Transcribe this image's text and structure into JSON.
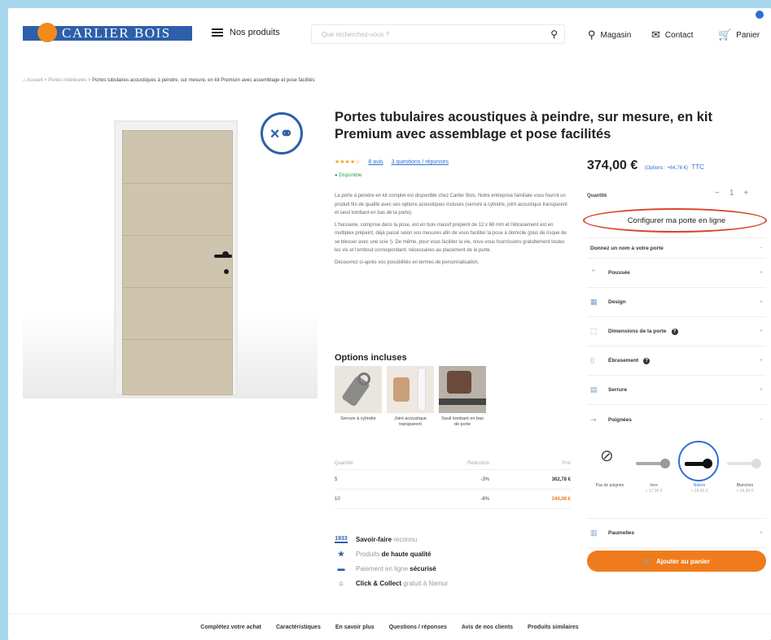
{
  "header": {
    "logo_text": "CARLIER BOIS",
    "products_label": "Nos produits",
    "search_placeholder": "Que recherchez-vous ?",
    "store_label": "Magasin",
    "contact_label": "Contact",
    "cart_label": "Panier"
  },
  "breadcrumb": {
    "home": "Accueil",
    "sep1": ">",
    "cat": "Portes intérieures",
    "sep2": ">",
    "current": "Portes tubulaires acoustiques à peindre, sur mesure, en kit Premium avec assemblage et pose facilités"
  },
  "product": {
    "title": "Portes tubulaires acoustiques à peindre, sur mesure, en kit Premium avec assemblage et pose facilités",
    "stars": "★★★★☆",
    "reviews_link": "8 avis",
    "questions_link": "3 questions / réponses",
    "stock": "Disponible",
    "desc_p1": "La porte à peindre en kit complet est disponible chez Carlier Bois. Notre entreprise familiale vous fournit un produit fini de qualité avec ses options acoustiques incluses (serrure à cylindre, joint acoustique transparent et seuil tombant en bas de la porte).",
    "desc_p2": "L'huisserie, comprise dans la pose, est en bois massif prépeint de 12 x 68 mm et l'ébrasement est en multiplex prépeint, déjà passé selon vos mesures afin de vous faciliter la pose à domicile (plus de risque de se blesser avec une scie !). De même, pour vous faciliter la vie, nous vous fournissons gratuitement toutes les vis et l'embout correspondant, nécessaires au placement de la porte.",
    "desc_p3": "Découvrez ci-après vos possibilités en termes de personnalisation."
  },
  "options": {
    "title": "Options incluses",
    "items": [
      {
        "label": "Serrure à cylindre"
      },
      {
        "label": "Joint acoustique transparent"
      },
      {
        "label": "Seuil tombant en bas de porte"
      }
    ]
  },
  "qty_table": {
    "headers": [
      "Quantité",
      "Réduction",
      "Prix"
    ],
    "rows": [
      {
        "qty": "5",
        "reduction": "-3%",
        "price": "362,78 €"
      },
      {
        "qty": "10",
        "reduction": "-8%",
        "price": "344,08 €"
      }
    ]
  },
  "features": [
    {
      "icon": "1933",
      "bold_first": "Savoir-faire",
      "rest": " reconnu"
    },
    {
      "icon": "★",
      "light": "Produits ",
      "bold": "de haute qualité"
    },
    {
      "icon": "▬",
      "light": "Paiement en ligne ",
      "bold": "sécurisé"
    },
    {
      "icon": "⌂",
      "bold_first": "Click & Collect",
      "rest": " gratuit à Namur"
    }
  ],
  "purchase": {
    "price": "374,00 €",
    "price_options": "(Options : +64,76 €)",
    "price_ttc": "TTC",
    "qty_label": "Quantité",
    "qty_value": "1",
    "minus": "−",
    "plus": "+",
    "config_button": "Configurer ma porte en ligne",
    "add_to_cart": "Ajouter au panier"
  },
  "accordion": [
    {
      "label": "Donnez un nom à votre porte",
      "icon": "",
      "chev": "−"
    },
    {
      "label": "Poussée",
      "icon": "⌃",
      "chev": "+"
    },
    {
      "label": "Design",
      "icon": "▦",
      "chev": "+"
    },
    {
      "label": "Dimensions de la porte",
      "icon": "⬚",
      "chev": "+",
      "help": "?"
    },
    {
      "label": "Ébrasement",
      "icon": "⌷",
      "chev": "+",
      "help": "?"
    },
    {
      "label": "Serrure",
      "icon": "▤",
      "chev": "+"
    },
    {
      "label": "Poignées",
      "icon": "⊸",
      "chev": "−"
    }
  ],
  "handles": [
    {
      "label": "Pas de poignée",
      "sub": ""
    },
    {
      "label": "Inox",
      "sub": "+ 17,90 €"
    },
    {
      "label": "Noires",
      "sub": "+ 26,00 €"
    },
    {
      "label": "Blanches",
      "sub": "+ 26,00 €"
    }
  ],
  "hinges": {
    "label": "Paumelles",
    "icon": "▥",
    "chev": "+"
  },
  "bottom_nav": [
    "Complétez votre achat",
    "Caractéristiques",
    "En savoir plus",
    "Questions / réponses",
    "Avis de nos clients",
    "Produits similaires"
  ],
  "colors": {
    "brand_blue": "#2d5faa",
    "orange": "#f07b1c",
    "highlight_red": "#d9432e",
    "select_blue": "#2d6fd6"
  }
}
